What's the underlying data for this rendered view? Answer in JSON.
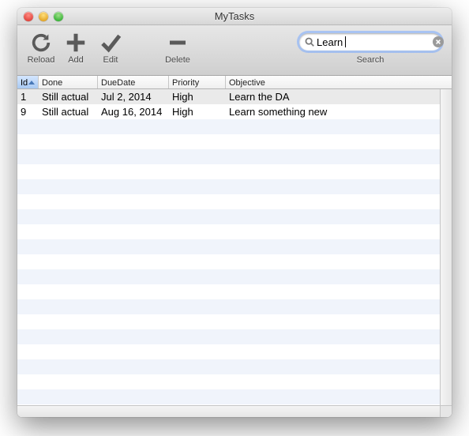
{
  "window": {
    "title": "MyTasks"
  },
  "toolbar": {
    "reload": "Reload",
    "add": "Add",
    "edit": "Edit",
    "delete": "Delete"
  },
  "search": {
    "label": "Search",
    "value": "Learn",
    "placeholder": ""
  },
  "columns": {
    "id": "Id",
    "done": "Done",
    "due": "DueDate",
    "priority": "Priority",
    "objective": "Objective"
  },
  "sort": {
    "column": "id",
    "direction": "asc"
  },
  "rows": [
    {
      "id": "1",
      "done": "Still actual",
      "due": "Jul 2, 2014",
      "priority": "High",
      "objective": "Learn the DA"
    },
    {
      "id": "9",
      "done": "Still actual",
      "due": "Aug 16, 2014",
      "priority": "High",
      "objective": "Learn something new"
    }
  ]
}
